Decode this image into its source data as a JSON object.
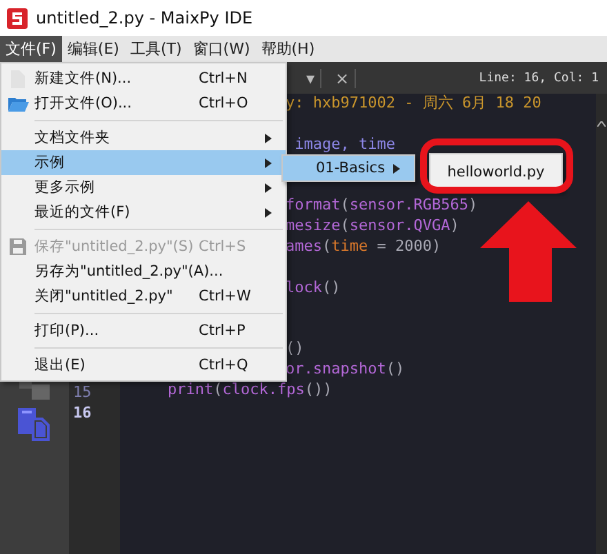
{
  "window": {
    "title": "untitled_2.py - MaixPy IDE"
  },
  "menu_bar": [
    {
      "label": "文件(F)",
      "selected": true
    },
    {
      "label": "编辑(E)",
      "selected": false
    },
    {
      "label": "工具(T)",
      "selected": false
    },
    {
      "label": "窗口(W)",
      "selected": false
    },
    {
      "label": "帮助(H)",
      "selected": false
    }
  ],
  "editor_bar": {
    "caret": "▾",
    "close": "×",
    "position": "Line: 16, Col: 1"
  },
  "line_numbers": [
    {
      "number": "15",
      "current": false
    },
    {
      "number": "16",
      "current": true
    }
  ],
  "code_lines": [
    {
      "kind": "code",
      "tokens": [
        {
          "text": "y: hxb971002 - 周六 6月 18 20",
          "kind": "comment"
        }
      ]
    },
    {
      "kind": "blank"
    },
    {
      "kind": "code",
      "tokens": [
        {
          "text": " image, time",
          "kind": "module"
        }
      ]
    },
    {
      "kind": "blank"
    },
    {
      "kind": "blank"
    },
    {
      "kind": "code",
      "tokens": [
        {
          "text": "format",
          "kind": "call"
        },
        {
          "text": "(",
          "kind": "punct"
        },
        {
          "text": "sensor.RGB565",
          "kind": "call"
        },
        {
          "text": ")",
          "kind": "punct"
        }
      ]
    },
    {
      "kind": "code",
      "tokens": [
        {
          "text": "mesize",
          "kind": "call"
        },
        {
          "text": "(",
          "kind": "punct"
        },
        {
          "text": "sensor.QVGA",
          "kind": "call"
        },
        {
          "text": ")",
          "kind": "punct"
        }
      ]
    },
    {
      "kind": "code",
      "tokens": [
        {
          "text": "ames",
          "kind": "call"
        },
        {
          "text": "(",
          "kind": "punct"
        },
        {
          "text": "time",
          "kind": "param"
        },
        {
          "text": " = 2000)",
          "kind": "punct"
        }
      ]
    },
    {
      "kind": "blank"
    },
    {
      "kind": "code",
      "tokens": [
        {
          "text": "lock",
          "kind": "call"
        },
        {
          "text": "()",
          "kind": "punct"
        }
      ]
    },
    {
      "kind": "blank"
    },
    {
      "kind": "blank"
    },
    {
      "kind": "code",
      "tokens": [
        {
          "text": "()",
          "kind": "punct"
        }
      ]
    },
    {
      "kind": "code",
      "tokens": [
        {
          "text": "or.snapshot",
          "kind": "call"
        },
        {
          "text": "()",
          "kind": "punct"
        }
      ]
    },
    {
      "kind": "code",
      "tokens": [
        {
          "text": "    print",
          "kind": "call"
        },
        {
          "text": "(",
          "kind": "punct"
        },
        {
          "text": "clock.fps",
          "kind": "call"
        },
        {
          "text": "())",
          "kind": "punct"
        }
      ]
    },
    {
      "kind": "blank"
    }
  ],
  "file_menu": [
    {
      "kind": "item",
      "label": "新建文件(N)...",
      "shortcut": "Ctrl+N",
      "submenu": false,
      "disabled": false,
      "selected": false
    },
    {
      "kind": "item",
      "label": "打开文件(O)...",
      "shortcut": "Ctrl+O",
      "submenu": false,
      "disabled": false,
      "selected": false
    },
    {
      "kind": "separator"
    },
    {
      "kind": "item",
      "label": "文档文件夹",
      "submenu": true,
      "disabled": false,
      "selected": false
    },
    {
      "kind": "item",
      "label": "示例",
      "submenu": true,
      "disabled": false,
      "selected": true
    },
    {
      "kind": "item",
      "label": "更多示例",
      "submenu": true,
      "disabled": false,
      "selected": false
    },
    {
      "kind": "item",
      "label": "最近的文件(F)",
      "submenu": true,
      "disabled": false,
      "selected": false
    },
    {
      "kind": "separator"
    },
    {
      "kind": "item",
      "label": "保存\"untitled_2.py\"(S)",
      "shortcut": "Ctrl+S",
      "submenu": false,
      "disabled": true,
      "selected": false
    },
    {
      "kind": "item",
      "label": "另存为\"untitled_2.py\"(A)...",
      "submenu": false,
      "disabled": false,
      "selected": false
    },
    {
      "kind": "item",
      "label": "关闭\"untitled_2.py\"",
      "shortcut": "Ctrl+W",
      "submenu": false,
      "disabled": false,
      "selected": false
    },
    {
      "kind": "separator"
    },
    {
      "kind": "item",
      "label": "打印(P)...",
      "shortcut": "Ctrl+P",
      "submenu": false,
      "disabled": false,
      "selected": false
    },
    {
      "kind": "separator"
    },
    {
      "kind": "item",
      "label": "退出(E)",
      "shortcut": "Ctrl+Q",
      "submenu": false,
      "disabled": false,
      "selected": false
    }
  ],
  "examples_submenu": [
    {
      "label": "01-Basics",
      "submenu": true,
      "selected": true
    }
  ],
  "basics_submenu": [
    {
      "label": "helloworld.py",
      "selected": false
    }
  ]
}
